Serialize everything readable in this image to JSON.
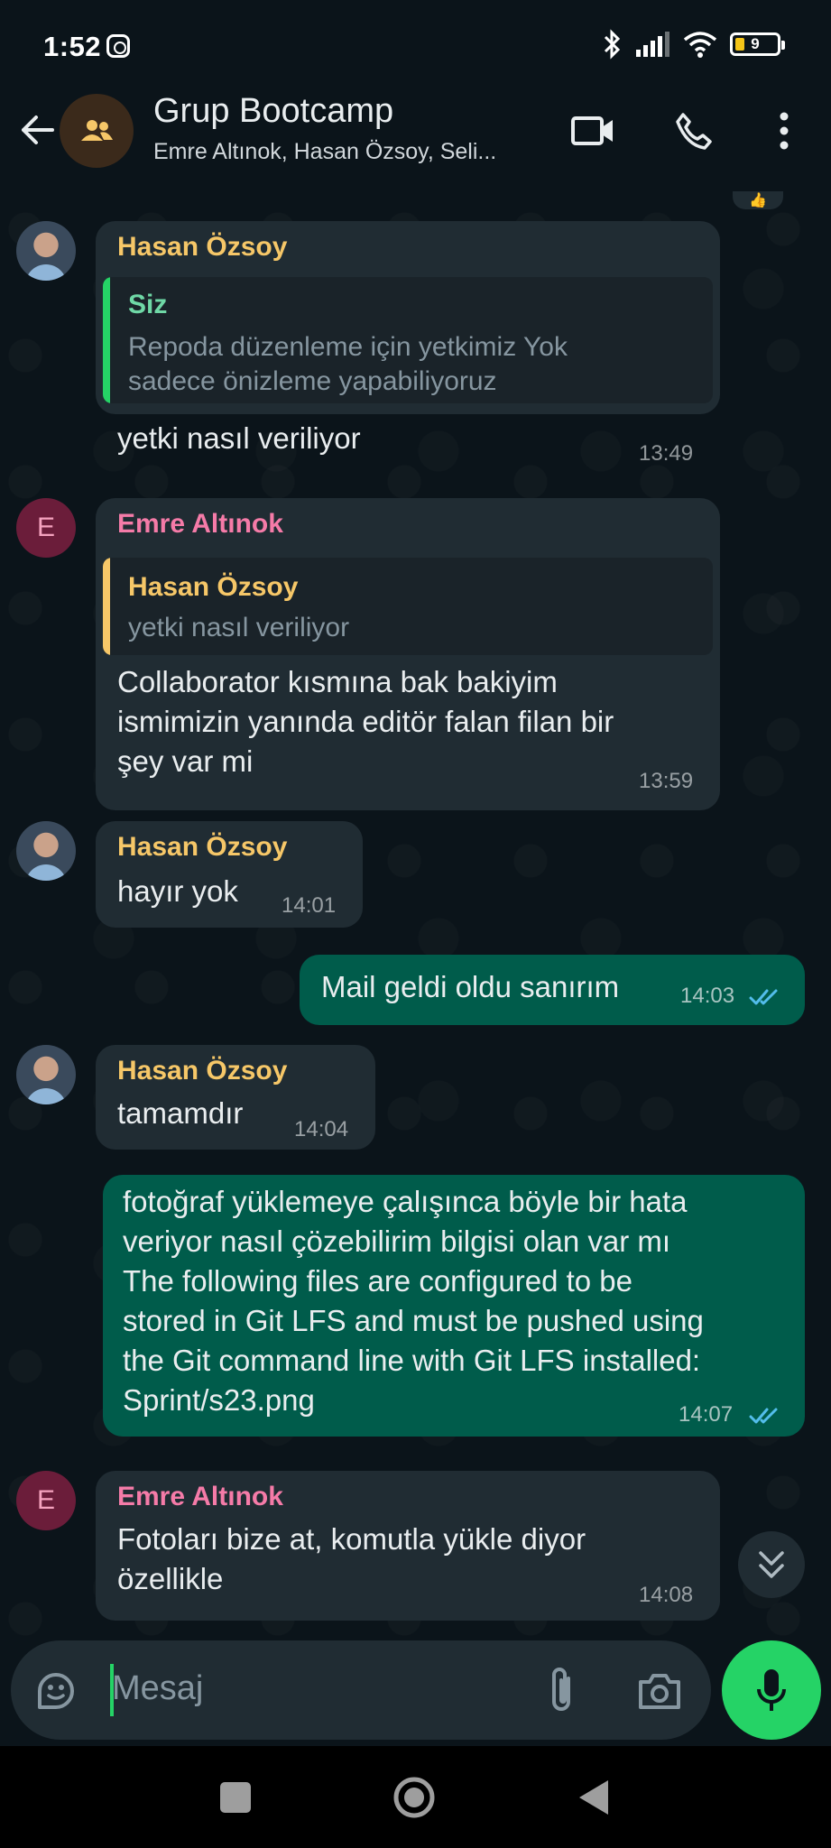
{
  "status": {
    "time": "1:52",
    "battery": "9"
  },
  "header": {
    "title": "Grup Bootcamp",
    "subtitle": "Emre Altınok, Hasan Özsoy, Seli..."
  },
  "messages": [
    {
      "sender": "Hasan Özsoy",
      "quote_name": "Siz",
      "quote_text_1": "Repoda düzenleme için yetkimiz Yok",
      "quote_text_2": "sadece önizleme yapabiliyoruz",
      "text": "yetki nasıl veriliyor",
      "time": "13:49"
    },
    {
      "sender": "Emre Altınok",
      "avatar_letter": "E",
      "quote_name": "Hasan Özsoy",
      "quote_text_1": "yetki nasıl veriliyor",
      "text_1": "Collaborator kısmına bak bakiyim",
      "text_2": "ismimizin yanında editör falan filan bir",
      "text_3": "şey var mi",
      "time": "13:59"
    },
    {
      "sender": "Hasan Özsoy",
      "text": "hayır yok",
      "time": "14:01"
    },
    {
      "text": "Mail geldi oldu sanırım",
      "time": "14:03"
    },
    {
      "sender": "Hasan Özsoy",
      "text": "tamamdır",
      "time": "14:04"
    },
    {
      "text_1": "fotoğraf yüklemeye çalışınca böyle bir hata",
      "text_2": "veriyor nasıl çözebilirim bilgisi olan var mı",
      "text_3": "The following files are configured to be",
      "text_4": "stored in Git LFS and must be pushed using",
      "text_5": "the Git command line with Git LFS installed:",
      "text_6": "Sprint/s23.png",
      "time": "14:07"
    },
    {
      "sender": "Emre Altınok",
      "avatar_letter": "E",
      "text_1": "Fotoları bize at, komutla yükle diyor",
      "text_2": "özellikle",
      "time": "14:08"
    }
  ],
  "input": {
    "placeholder": "Mesaj"
  },
  "icons": {
    "back": "arrow-left-icon",
    "video": "video-call-icon",
    "call": "phone-icon",
    "menu": "more-vert-icon",
    "sticker": "sticker-icon",
    "attach": "paperclip-icon",
    "camera": "camera-icon",
    "mic": "mic-icon",
    "scroll": "double-chevron-down-icon"
  },
  "colors": {
    "background": "#0b141a",
    "incoming": "#202c33",
    "outgoing": "#005c4b",
    "accent": "#25d366",
    "hasan": "#f6c768",
    "emre": "#f57ba8",
    "read_ticks": "#53bdeb"
  }
}
